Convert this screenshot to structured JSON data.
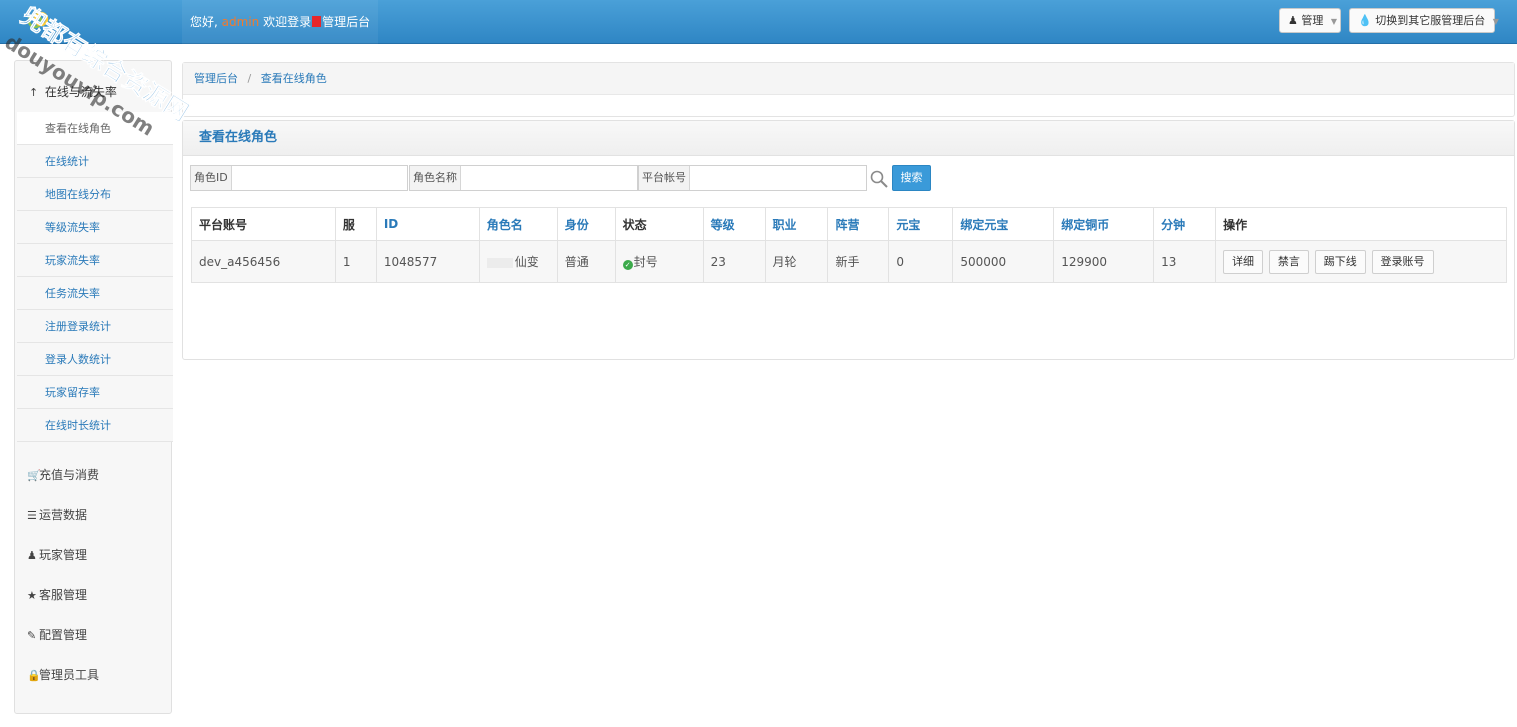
{
  "topbar": {
    "greeting_prefix": "您好,",
    "username": "admin",
    "greeting_mid": "欢迎登录",
    "greeting_suffix": "管理后台",
    "manage_btn": "管理",
    "switch_btn": "切换到其它服管理后台"
  },
  "sidebar": {
    "section_title": "在线与流失率",
    "items": [
      {
        "label": "查看在线角色"
      },
      {
        "label": "在线统计"
      },
      {
        "label": "地图在线分布"
      },
      {
        "label": "等级流失率"
      },
      {
        "label": "玩家流失率"
      },
      {
        "label": "任务流失率"
      },
      {
        "label": "注册登录统计"
      },
      {
        "label": "登录人数统计"
      },
      {
        "label": "玩家留存率"
      },
      {
        "label": "在线时长统计"
      }
    ],
    "groups": [
      {
        "label": "充值与消费",
        "icon": "cart-icon"
      },
      {
        "label": "运营数据",
        "icon": "list-icon"
      },
      {
        "label": "玩家管理",
        "icon": "user-icon"
      },
      {
        "label": "客服管理",
        "icon": "star-icon"
      },
      {
        "label": "配置管理",
        "icon": "edit-icon"
      },
      {
        "label": "管理员工具",
        "icon": "lock-icon"
      }
    ]
  },
  "breadcrumb": {
    "home": "管理后台",
    "separator": "/",
    "current": "查看在线角色"
  },
  "panel": {
    "title": "查看在线角色"
  },
  "search": {
    "role_id_label": "角色ID",
    "role_name_label": "角色名称",
    "account_label": "平台帐号",
    "role_id_value": "",
    "role_name_value": "",
    "account_value": "",
    "button": "搜索"
  },
  "table": {
    "headers": [
      "平台账号",
      "服",
      "ID",
      "角色名",
      "身份",
      "状态",
      "等级",
      "职业",
      "阵营",
      "元宝",
      "绑定元宝",
      "绑定铜币",
      "分钟",
      "操作"
    ],
    "rows": [
      {
        "account": "dev_a456456",
        "server": "1",
        "id": "1048577",
        "name": "仙变",
        "identity": "普通",
        "status": "封号",
        "level": "23",
        "profession": "月轮",
        "camp": "新手",
        "yuanbao": "0",
        "bind_yuanbao": "500000",
        "bind_copper": "129900",
        "minutes": "13"
      }
    ],
    "actions": [
      "详细",
      "禁言",
      "踢下线",
      "登录账号"
    ]
  },
  "watermark": {
    "line1": "兜都有综合资源网",
    "line2": "douyouvip.com"
  },
  "colors": {
    "topbar": "#3a93cf",
    "link": "#2a7ab9",
    "button_primary": "#3a9ad9",
    "admin_name": "#f37a2b",
    "status_ok": "#3caa4b"
  }
}
